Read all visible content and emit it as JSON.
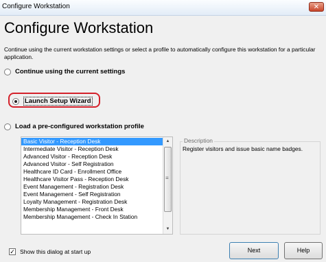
{
  "window": {
    "title": "Configure Workstation",
    "close_glyph": "✕"
  },
  "heading": "Configure Workstation",
  "intro": "Continue using the current workstation settings or select a profile to automatically configure this workstation for a particular application.",
  "options": {
    "continue_label": "Continue using the current settings",
    "wizard_label": "Launch Setup Wizard",
    "profile_label": "Load a pre-configured workstation profile",
    "selected": "wizard"
  },
  "profile_list": {
    "items": [
      "Basic Visitor - Reception Desk",
      "Intermediate Visitor - Reception Desk",
      "Advanced Visitor - Reception Desk",
      "Advanced Visitor - Self Registration",
      "Healthcare ID Card - Enrollment Office",
      "Healthcare Visitor Pass - Reception Desk",
      "Event Management - Registration Desk",
      "Event Management - Self Registration",
      "Loyalty Management - Registration Desk",
      "Membership Management - Front Desk",
      "Membership Management - Check In Station"
    ],
    "selected_index": 0
  },
  "description": {
    "legend": "Description",
    "text": "Register visitors and issue basic name badges."
  },
  "footer": {
    "show_dialog_label": "Show this dialog at start up",
    "show_dialog_checked": true,
    "next_label": "Next",
    "help_label": "Help"
  },
  "colors": {
    "highlight_ring": "#d4202a",
    "selection": "#3399ff"
  }
}
